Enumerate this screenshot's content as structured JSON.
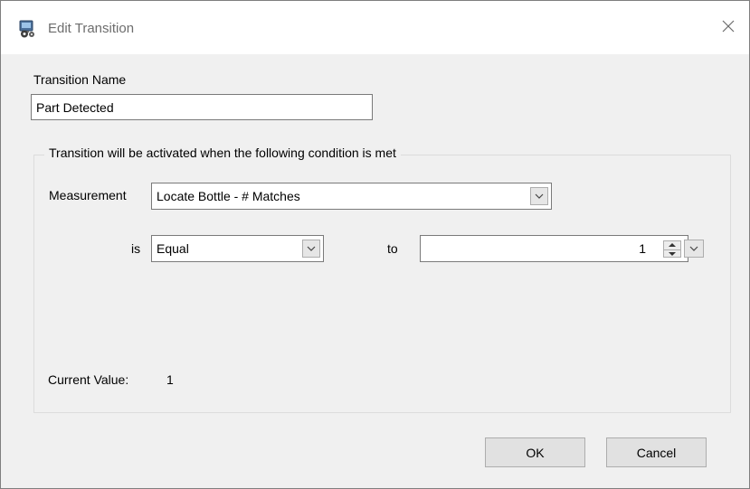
{
  "window": {
    "title": "Edit Transition",
    "icon": "settings-app-icon",
    "close_icon": "close-icon"
  },
  "name_section": {
    "label": "Transition Name",
    "value": "Part Detected"
  },
  "condition_group": {
    "legend": "Transition will be activated when the following condition is met",
    "measurement_label": "Measurement",
    "measurement_value": "Locate Bottle - # Matches",
    "is_label": "is",
    "operator_value": "Equal",
    "to_label": "to",
    "threshold_value": "1",
    "current_value_label": "Current Value:",
    "current_value": "1"
  },
  "buttons": {
    "ok": "OK",
    "cancel": "Cancel"
  }
}
